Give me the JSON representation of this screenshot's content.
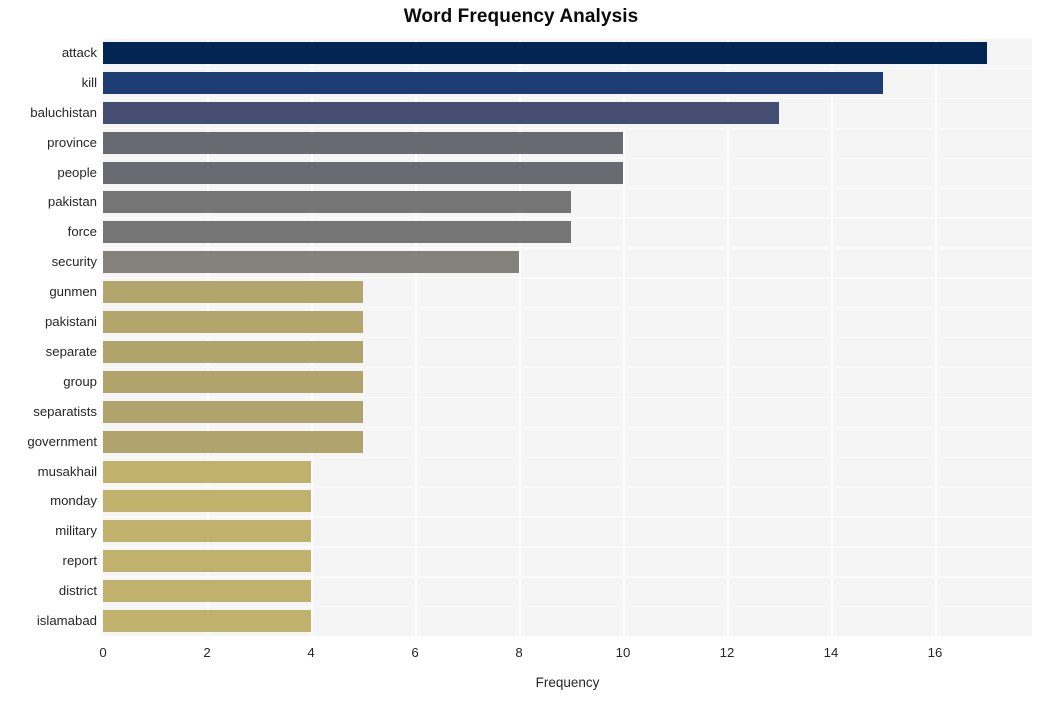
{
  "chart_data": {
    "type": "bar",
    "orientation": "horizontal",
    "title": "Word Frequency Analysis",
    "xlabel": "Frequency",
    "ylabel": "",
    "categories": [
      "attack",
      "kill",
      "baluchistan",
      "province",
      "people",
      "pakistan",
      "force",
      "security",
      "gunmen",
      "pakistani",
      "separate",
      "group",
      "separatists",
      "government",
      "musakhail",
      "monday",
      "military",
      "report",
      "district",
      "islamabad"
    ],
    "values": [
      17,
      15,
      13,
      10,
      10,
      9,
      9,
      8,
      5,
      5,
      5,
      5,
      5,
      5,
      4,
      4,
      4,
      4,
      4,
      4
    ],
    "bar_colors": [
      "#032554",
      "#1c3c73",
      "#454f73",
      "#686a72",
      "#6a6b72",
      "#757575",
      "#757575",
      "#84827a",
      "#b2a66d",
      "#b2a66d",
      "#b0a46c",
      "#b0a46c",
      "#b0a46c",
      "#b0a46c",
      "#c0b26c",
      "#c0b26c",
      "#c0b26c",
      "#c0b26c",
      "#c0b26c",
      "#c0b26c"
    ],
    "xticks": [
      0,
      2,
      4,
      6,
      8,
      10,
      12,
      14,
      16
    ],
    "xtick_labels": [
      "0",
      "2",
      "4",
      "6",
      "8",
      "10",
      "12",
      "14",
      "16"
    ],
    "xlim": [
      0,
      17.85
    ],
    "grid": true,
    "grid_axis": "both",
    "legend": null,
    "plot_background": "#f5f5f5",
    "figure_background": "#ffffff",
    "grid_color": "#ffffff"
  }
}
